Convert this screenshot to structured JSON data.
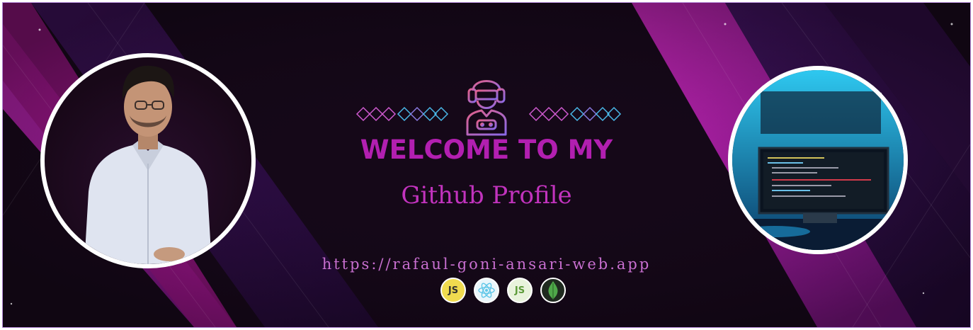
{
  "banner": {
    "headline": "WELCOME TO MY",
    "subhead": "Github Profile",
    "url": "https://rafaul-goni-ansari-web.app"
  },
  "tech_icons": [
    {
      "name": "javascript",
      "label": "JS"
    },
    {
      "name": "react",
      "label": ""
    },
    {
      "name": "nodejs",
      "label": "JS"
    },
    {
      "name": "mongodb",
      "label": ""
    }
  ],
  "colors": {
    "background": "#150818",
    "magenta": "#c41aae",
    "purple": "#3b1252",
    "headline": "#b21fb0",
    "url": "#c86fd0",
    "diamond_pink": "#d05ad0",
    "diamond_blue": "#4ab8e8"
  },
  "icons": {
    "left_avatar": "person-portrait-photo",
    "right_avatar": "desk-computer-photo",
    "mascot": "gamer-with-headset-icon"
  }
}
